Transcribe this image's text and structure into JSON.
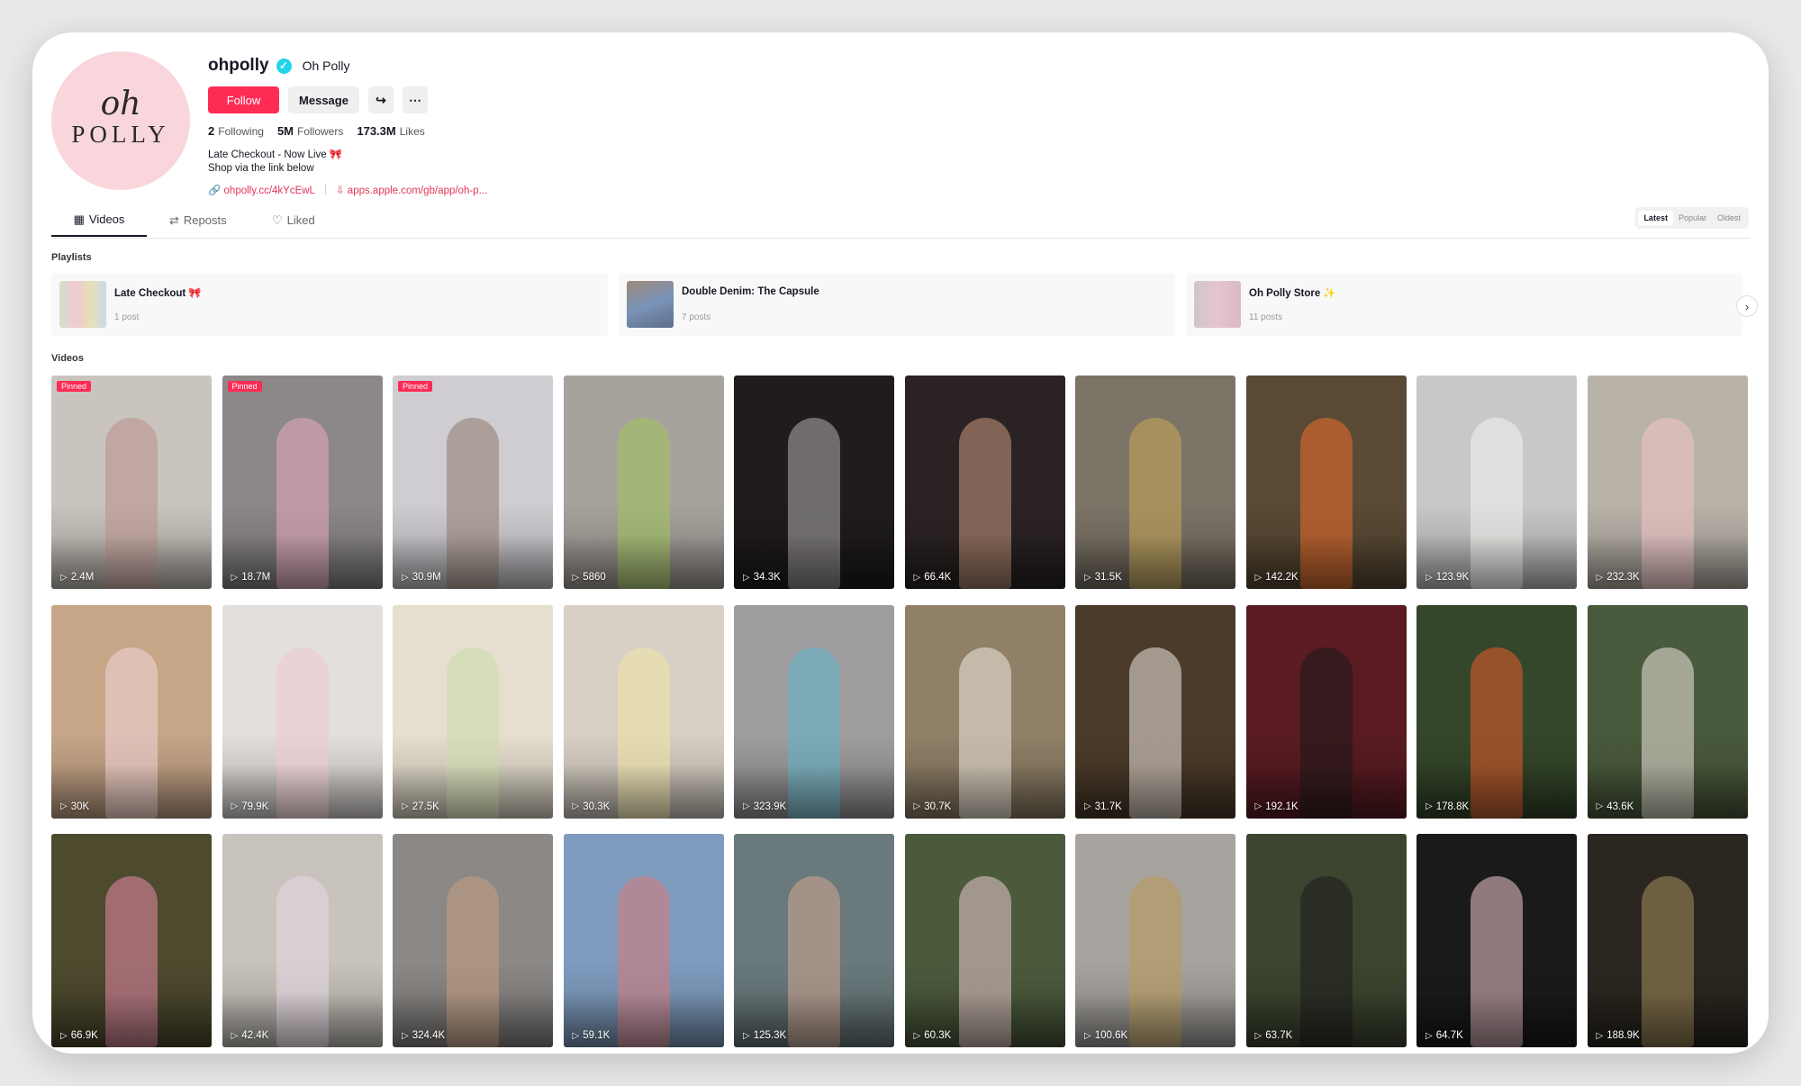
{
  "profile": {
    "username": "ohpolly",
    "nickname": "Oh Polly",
    "avatar_text_1": "oh",
    "avatar_text_2": "POLLY",
    "follow_label": "Follow",
    "message_label": "Message",
    "stats": {
      "following_count": "2",
      "following_label": "Following",
      "followers_count": "5M",
      "followers_label": "Followers",
      "likes_count": "173.3M",
      "likes_label": "Likes"
    },
    "bio_line_1": "Late Checkout - Now Live 🎀",
    "bio_line_2": "Shop via the link below",
    "link_1": "ohpolly.cc/4kYcEwL",
    "link_2": "apps.apple.com/gb/app/oh-p..."
  },
  "tabs": [
    {
      "label": "Videos",
      "icon": "grid-icon"
    },
    {
      "label": "Reposts",
      "icon": "repost-icon"
    },
    {
      "label": "Liked",
      "icon": "heart-outline-icon"
    }
  ],
  "sort": {
    "options": [
      "Latest",
      "Popular",
      "Oldest"
    ],
    "selected": "Latest"
  },
  "playlists_title": "Playlists",
  "playlists": [
    {
      "title": "Late Checkout 🎀",
      "count": "1 post",
      "thumb": "#cfe3c9"
    },
    {
      "title": "Double Denim: The Capsule",
      "count": "7 posts",
      "thumb": "#7a93b8"
    },
    {
      "title": "Oh Polly Store ✨",
      "count": "11 posts",
      "thumb": "#e6c4d2"
    }
  ],
  "videos_title": "Videos",
  "pinned_label": "Pinned",
  "videos": [
    {
      "views": "2.4M",
      "pinned": true,
      "bg": "#c9c4bd",
      "fig": "#b98f8a"
    },
    {
      "views": "18.7M",
      "pinned": true,
      "bg": "#8c8888",
      "fig": "#e8a9bb"
    },
    {
      "views": "30.9M",
      "pinned": true,
      "bg": "#cfcdd2",
      "fig": "#8f7a6c"
    },
    {
      "views": "5860",
      "pinned": false,
      "bg": "#a8a29c",
      "fig": "#9fc65a"
    },
    {
      "views": "34.3K",
      "pinned": false,
      "bg": "#1f1c1b",
      "fig": "#b2aeb0"
    },
    {
      "views": "66.4K",
      "pinned": false,
      "bg": "#2b2323",
      "fig": "#c99a80"
    },
    {
      "views": "31.5K",
      "pinned": false,
      "bg": "#7d7468",
      "fig": "#c8a753"
    },
    {
      "views": "142.2K",
      "pinned": false,
      "bg": "#5a4a35",
      "fig": "#ef6d2a"
    },
    {
      "views": "123.9K",
      "pinned": false,
      "bg": "#c8c8c8",
      "fig": "#f5f3ee"
    },
    {
      "views": "232.3K",
      "pinned": false,
      "bg": "#b9b2a9",
      "fig": "#f2c4c9"
    },
    {
      "views": "30K",
      "pinned": false,
      "bg": "#c7a688",
      "fig": "#f3d6da"
    },
    {
      "views": "79.9K",
      "pinned": false,
      "bg": "#e3dfdc",
      "fig": "#f0c9cf"
    },
    {
      "views": "27.5K",
      "pinned": false,
      "bg": "#e6dfcf",
      "fig": "#c9dba9"
    },
    {
      "views": "30.3K",
      "pinned": false,
      "bg": "#d8d0c5",
      "fig": "#f1e6a6"
    },
    {
      "views": "323.9K",
      "pinned": false,
      "bg": "#a09da0",
      "fig": "#5db5c8"
    },
    {
      "views": "30.7K",
      "pinned": false,
      "bg": "#8f8067",
      "fig": "#eeeae2"
    },
    {
      "views": "31.7K",
      "pinned": false,
      "bg": "#4b3b2a",
      "fig": "#efe8e2"
    },
    {
      "views": "192.1K",
      "pinned": false,
      "bg": "#5a1b22",
      "fig": "#1a1a1a"
    },
    {
      "views": "178.8K",
      "pinned": false,
      "bg": "#35472a",
      "fig": "#e85b2b"
    },
    {
      "views": "43.6K",
      "pinned": false,
      "bg": "#4a5a3c",
      "fig": "#eee8e0"
    },
    {
      "views": "66.9K",
      "pinned": false,
      "bg": "#4e4a2e",
      "fig": "#e58aa9"
    },
    {
      "views": "42.4K",
      "pinned": false,
      "bg": "#c8c4bd",
      "fig": "#e7d9e6"
    },
    {
      "views": "324.4K",
      "pinned": false,
      "bg": "#8b8886",
      "fig": "#c79e7f"
    },
    {
      "views": "59.1K",
      "pinned": false,
      "bg": "#7f9cbf",
      "fig": "#d87a7a"
    },
    {
      "views": "125.3K",
      "pinned": false,
      "bg": "#6a7a7c",
      "fig": "#d3a591"
    },
    {
      "views": "60.3K",
      "pinned": false,
      "bg": "#4c5a3c",
      "fig": "#eacbcf"
    },
    {
      "views": "100.6K",
      "pinned": false,
      "bg": "#a7a4a0",
      "fig": "#b99954"
    },
    {
      "views": "63.7K",
      "pinned": false,
      "bg": "#3d4530",
      "fig": "#1c1c1c"
    },
    {
      "views": "64.7K",
      "pinned": false,
      "bg": "#1a1a1a",
      "fig": "#f2c9d0"
    },
    {
      "views": "188.9K",
      "pinned": false,
      "bg": "#2b2720",
      "fig": "#a8905c"
    }
  ],
  "colors": {
    "accent": "#fe2c55",
    "link": "#e2365c",
    "verified": "#20d5ec"
  }
}
